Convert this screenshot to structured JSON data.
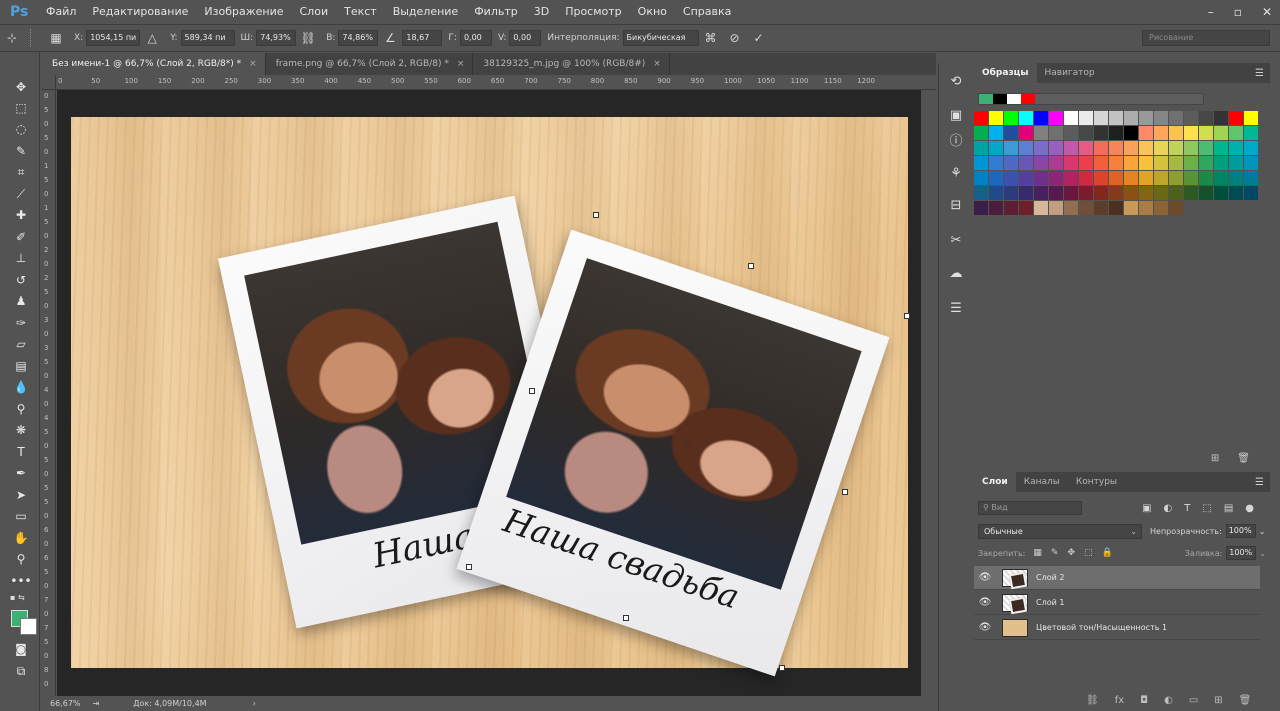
{
  "app": {
    "logo": "Ps"
  },
  "menu": [
    "Файл",
    "Редактирование",
    "Изображение",
    "Слои",
    "Текст",
    "Выделение",
    "Фильтр",
    "3D",
    "Просмотр",
    "Окно",
    "Справка"
  ],
  "options": {
    "x_label": "X:",
    "x_value": "1054,15 пи",
    "y_label": "Y:",
    "y_value": "589,34 пи",
    "w_label": "Ш:",
    "w_value": "74,93%",
    "h_label": "В:",
    "h_value": "74,86%",
    "angle_value": "18,67",
    "hskew_label": "Г:",
    "hskew_value": "0,00",
    "vskew_label": "V:",
    "vskew_value": "0,00",
    "interp_label": "Интерполяция:",
    "interp_value": "Бикубическая",
    "workspace": "Рисование"
  },
  "tabs": [
    {
      "label": "Без имени-1 @ 66,7% (Слой 2, RGB/8*) *",
      "close": "×"
    },
    {
      "label": "frame.png @ 66,7% (Слой 2, RGB/8) *",
      "close": "×"
    },
    {
      "label": "38129325_m.jpg @ 100% (RGB/8#)",
      "close": "×"
    }
  ],
  "ruler": {
    "top": [
      "0",
      "50",
      "100",
      "150",
      "200",
      "250",
      "300",
      "350",
      "400",
      "450",
      "500",
      "550",
      "600",
      "650",
      "700",
      "750",
      "800",
      "850",
      "900",
      "950",
      "1000",
      "1050",
      "1100",
      "1150",
      "1200"
    ],
    "left": [
      "0",
      "5",
      "0",
      "5",
      "0",
      "1",
      "5",
      "0",
      "1",
      "5",
      "0",
      "2",
      "0",
      "2",
      "5",
      "0",
      "3",
      "0",
      "3",
      "5",
      "0",
      "4",
      "0",
      "4",
      "5",
      "0",
      "5",
      "0",
      "5",
      "5",
      "0",
      "6",
      "0",
      "6",
      "5",
      "0",
      "7",
      "0",
      "7",
      "5",
      "0",
      "8",
      "0"
    ]
  },
  "canvas": {
    "caption_back": "Наша",
    "caption_front": "Наша свадьба"
  },
  "status": {
    "zoom": "66,67%",
    "doc": "Док: 4,09M/10,4M"
  },
  "swatches_panel": {
    "tabs": [
      "Образцы",
      "Навигатор"
    ],
    "recent": [
      "#3bb273",
      "#000000",
      "#ffffff",
      "#ff0000"
    ],
    "colors": [
      "#ff0000",
      "#ffff00",
      "#00ff00",
      "#00ffff",
      "#0000ff",
      "#ff00ff",
      "#ffffff",
      "#ebebeb",
      "#d6d6d6",
      "#c2c2c2",
      "#adadad",
      "#999999",
      "#858585",
      "#707070",
      "#5c5c5c",
      "#474747",
      "#333333",
      "#ff0000",
      "#ffff00",
      "#00b050",
      "#00b0f0",
      "#1f4e9e",
      "#e0007a",
      "#808080",
      "#707070",
      "#5c5c5c",
      "#474747",
      "#333333",
      "#1f1f1f",
      "#000000",
      "#ff8a65",
      "#ffa65c",
      "#ffc34d",
      "#ffe14d",
      "#d0e04c",
      "#a3d353",
      "#61c66b",
      "#00b796",
      "#00a3a3",
      "#00a7c9",
      "#3e9ad6",
      "#5c7fd3",
      "#7a6cc8",
      "#9b5fbf",
      "#c25aa9",
      "#e85a86",
      "#f26d5b",
      "#f6855a",
      "#f9a35a",
      "#fcc35a",
      "#e8d45a",
      "#c1d25c",
      "#8fc860",
      "#4cbc70",
      "#00b68f",
      "#00b0ad",
      "#00a9c8",
      "#0096d6",
      "#2f7ed4",
      "#5169c4",
      "#6a56b5",
      "#8b45a5",
      "#ad3b91",
      "#d8386e",
      "#ed3e4b",
      "#f25f3a",
      "#f7813a",
      "#fba43a",
      "#f6c23c",
      "#d5c23e",
      "#a5b943",
      "#6faf4b",
      "#2ea65e",
      "#00a07f",
      "#009c9d",
      "#0096b9",
      "#0082c4",
      "#1e67bf",
      "#3c52b0",
      "#53409e",
      "#6f2f8b",
      "#8d2679",
      "#b2245f",
      "#d12a40",
      "#d9442a",
      "#de6327",
      "#e48525",
      "#e0a526",
      "#bfa52a",
      "#8f9d2f",
      "#589336",
      "#1b8a46",
      "#008461",
      "#00807e",
      "#007b99",
      "#155f8a",
      "#1c4c8a",
      "#2a3b80",
      "#362b70",
      "#46205f",
      "#57194f",
      "#6c163d",
      "#7c1b2b",
      "#81281e",
      "#853a18",
      "#8a5014",
      "#836512",
      "#6a6715",
      "#4d6218",
      "#2d5a1e",
      "#13532b",
      "#004f3e",
      "#004c52",
      "#004864",
      "#3a1f4a",
      "#4a1f3d",
      "#5c1f32",
      "#6e1f27",
      "#d6b79a",
      "#c2a07f",
      "#8f6e52",
      "#6e5039",
      "#5a3e2a",
      "#4a301f",
      "#c9995a",
      "#a97d45",
      "#8a6337",
      "#6b4b2a"
    ]
  },
  "layers_panel": {
    "tabs": [
      "Слои",
      "Каналы",
      "Контуры"
    ],
    "search_placeholder": "Вид",
    "blend_mode": "Обычные",
    "opacity_label": "Непрозрачность:",
    "opacity_value": "100%",
    "lock_label": "Закрепить:",
    "fill_label": "Заливка:",
    "fill_value": "100%",
    "layers": [
      {
        "name": "Слой 2",
        "selected": true,
        "kind": "photo"
      },
      {
        "name": "Слой 1",
        "selected": false,
        "kind": "photo"
      },
      {
        "name": "Цветовой тон/Насыщенность 1",
        "selected": false,
        "kind": "adjustment"
      }
    ]
  }
}
